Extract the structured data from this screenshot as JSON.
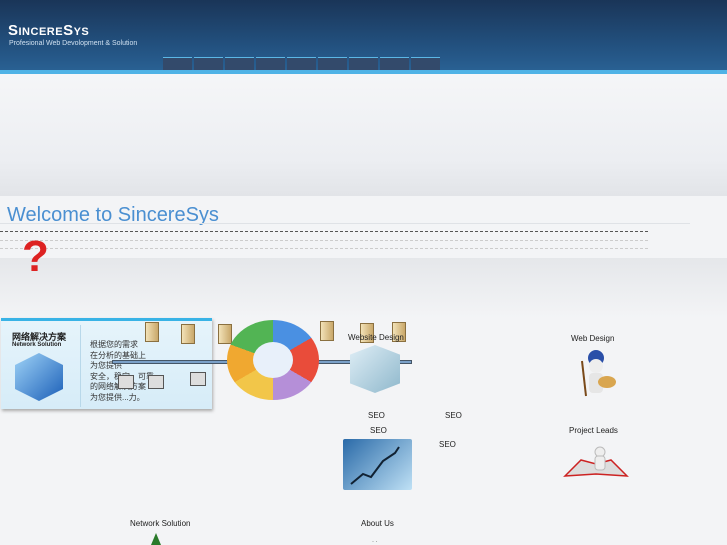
{
  "header": {
    "logo": "SincereSys",
    "tagline": "Profesional Web Devolopment & Solution"
  },
  "welcome": {
    "title": "Welcome to SincereSys"
  },
  "banner": {
    "title_cn": "网络解决方案",
    "title_en": "Network Solution",
    "lines": [
      "根据您的需求",
      "在分析的基础上",
      "为您提供",
      "安全，稳定，可靠",
      "的网络解决方案",
      "为您提供...力。"
    ]
  },
  "sections": {
    "website_design": "Website Design",
    "web_design": "Web Design",
    "seo1": "SEO",
    "seo2": "SEO",
    "seo3": "SEO",
    "seo4": "SEO",
    "project_leads": "Project Leads",
    "network_solution": "Network Solution",
    "about_us": "About Us",
    "about_dots": "· ·"
  }
}
